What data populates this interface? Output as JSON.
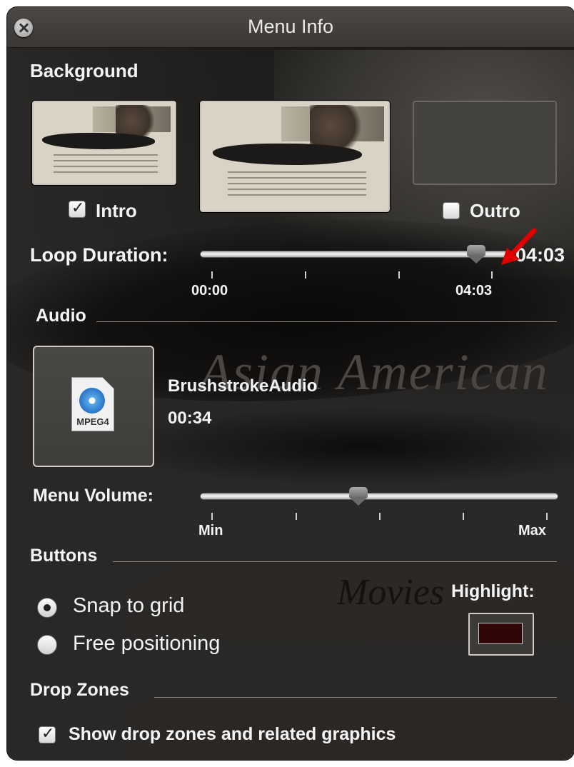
{
  "window": {
    "title": "Menu Info"
  },
  "background": {
    "section_label": "Background",
    "intro": {
      "label": "Intro",
      "checked": true
    },
    "outro": {
      "label": "Outro",
      "checked": false
    }
  },
  "loop_duration": {
    "label": "Loop Duration:",
    "value": "04:03",
    "start_label": "00:00",
    "end_label": "04:03",
    "position_fraction": 1.0
  },
  "background_art": {
    "title": "Asian American",
    "subtitle": "Movies"
  },
  "audio": {
    "section_label": "Audio",
    "file_name": "BrushstrokeAudio",
    "duration": "00:34",
    "file_type": "MPEG4"
  },
  "menu_volume": {
    "label": "Menu Volume:",
    "min_label": "Min",
    "max_label": "Max",
    "level_fraction": 0.44
  },
  "buttons": {
    "section_label": "Buttons",
    "snap_label": "Snap to grid",
    "free_label": "Free positioning",
    "selected": "Snap to grid",
    "highlight_label": "Highlight:",
    "highlight_color": "#300606"
  },
  "drop_zones": {
    "section_label": "Drop Zones",
    "show_label": "Show drop zones and related graphics",
    "checked": true
  },
  "colors": {
    "panel": "#252321",
    "annotation_arrow": "#e00000"
  }
}
